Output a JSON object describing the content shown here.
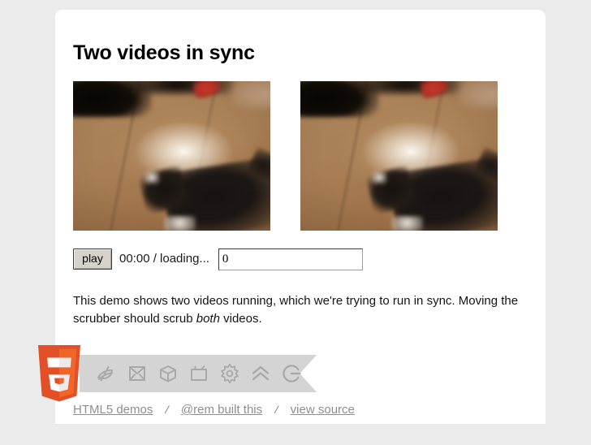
{
  "page": {
    "title": "Two videos in sync",
    "background_color": "#ebebeb",
    "card_color": "#ffffff"
  },
  "videos": [
    {
      "name": "video-left",
      "alt": "Blurry handheld clip of a black and white cat walking on a wooden floor with a bright light reflection"
    },
    {
      "name": "video-right",
      "alt": "Second copy of the same blurry cat on wooden floor clip, kept in sync"
    }
  ],
  "controls": {
    "play_label": "play",
    "time_status": "00:00 / loading...",
    "scrubber_value": "0",
    "scrubber_placeholder": "0"
  },
  "description": {
    "part1": "This demo shows two videos running, which we're trying to run in sync. Moving the scrubber should scrub ",
    "emphasis": "both",
    "part2": " videos."
  },
  "badge": {
    "logo_name": "html5-logo",
    "logo_text": "5",
    "logo_colors": {
      "dark": "#E34F26",
      "light": "#EF652A",
      "glyph": "#FFFFFF"
    },
    "ribbon_color": "#d4d4d4",
    "icon_color": "#a8a8a8",
    "icons": [
      "semantics-icon",
      "offline-storage-icon",
      "multimedia-3d-icon",
      "device-access-icon",
      "css3-styling-icon",
      "performance-icon",
      "connectivity-icon"
    ]
  },
  "footer": {
    "links": [
      {
        "label": "HTML5 demos"
      },
      {
        "label": "@rem built this"
      },
      {
        "label": "view source"
      }
    ],
    "separator": "/"
  }
}
